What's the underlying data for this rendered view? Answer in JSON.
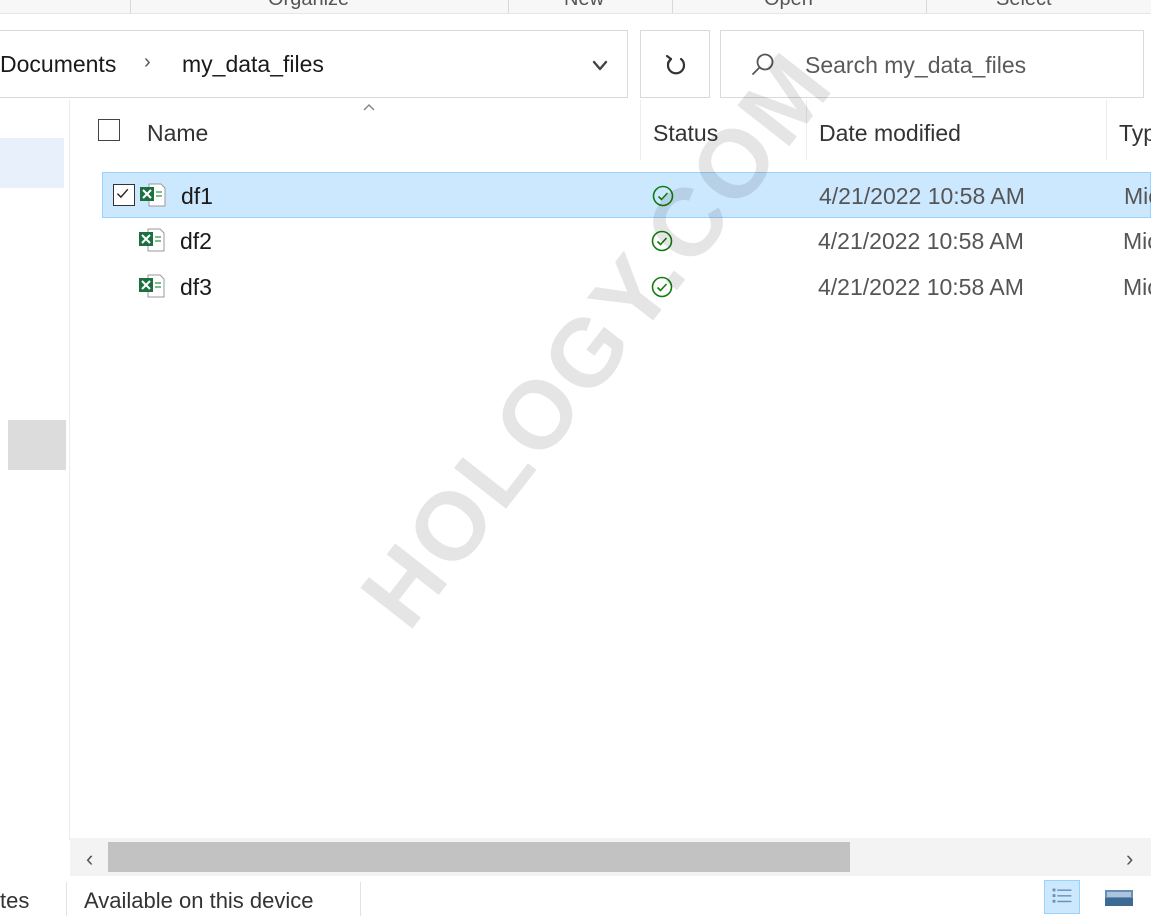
{
  "ribbon": {
    "groups": [
      "Organize",
      "New",
      "Open",
      "Select"
    ]
  },
  "address": {
    "crumbs": [
      "Documents",
      "my_data_files"
    ],
    "separator": "›"
  },
  "search": {
    "placeholder": "Search my_data_files"
  },
  "columns": {
    "name": "Name",
    "status": "Status",
    "date": "Date modified",
    "type": "Typ"
  },
  "files": [
    {
      "name": "df1",
      "date": "4/21/2022 10:58 AM",
      "type": "Mic",
      "selected": true
    },
    {
      "name": "df2",
      "date": "4/21/2022 10:58 AM",
      "type": "Mic",
      "selected": false
    },
    {
      "name": "df3",
      "date": "4/21/2022 10:58 AM",
      "type": "Mic",
      "selected": false
    }
  ],
  "statusbar": {
    "left": "tes",
    "availability": "Available on this device"
  },
  "icons": {
    "file": "excel-file-icon",
    "status": "available-locally-icon",
    "refresh": "refresh-icon",
    "search": "search-icon",
    "dropdown": "chevron-down-icon"
  },
  "colors": {
    "selection": "#cce8ff",
    "selection_border": "#99d1ff",
    "status_green": "#107c10",
    "excel_green": "#1d6f42"
  },
  "watermark": "HOLOGY.COM"
}
